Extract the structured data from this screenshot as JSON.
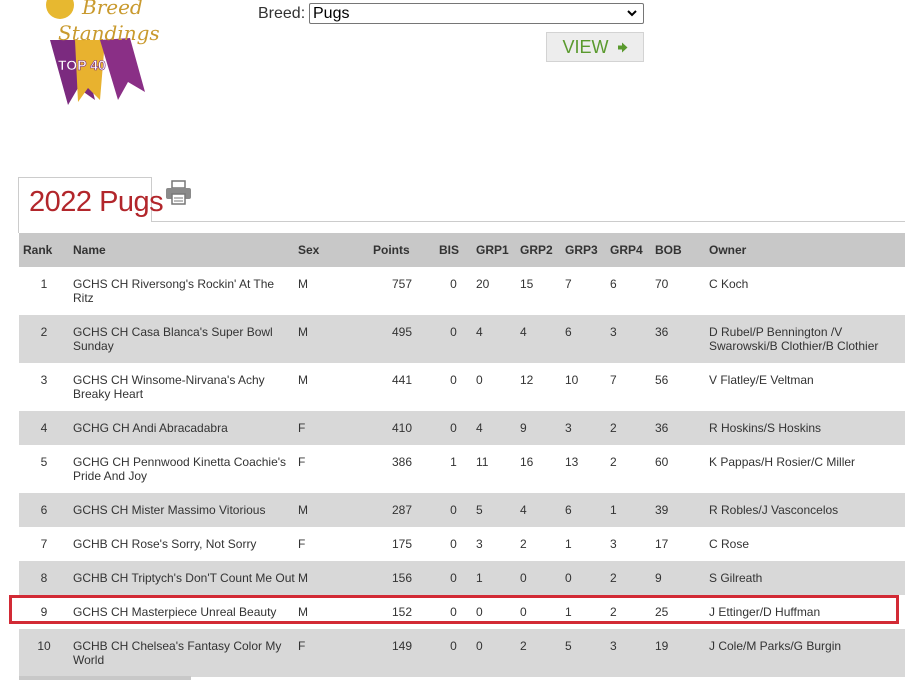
{
  "logo": {
    "text_script": "Breed Standings",
    "text_badge": "TOP 40"
  },
  "breed_selector": {
    "label": "Breed:",
    "selected": "Pugs"
  },
  "view_button": {
    "label": "VIEW"
  },
  "tab": {
    "title": "2022 Pugs"
  },
  "colors": {
    "accent_red": "#b2262b",
    "view_green": "#5a9a2e",
    "highlight": "#d22a35"
  },
  "table": {
    "headers": [
      "Rank",
      "Name",
      "Sex",
      "Points",
      "BIS",
      "GRP1",
      "GRP2",
      "GRP3",
      "GRP4",
      "BOB",
      "Owner"
    ],
    "rows": [
      {
        "rank": "1",
        "name": "GCHS CH Riversong's Rockin' At The Ritz",
        "sex": "M",
        "points": "757",
        "bis": "0",
        "grp1": "20",
        "grp2": "15",
        "grp3": "7",
        "grp4": "6",
        "bob": "70",
        "owner": "C Koch"
      },
      {
        "rank": "2",
        "name": "GCHS CH Casa Blanca's Super Bowl Sunday",
        "sex": "M",
        "points": "495",
        "bis": "0",
        "grp1": "4",
        "grp2": "4",
        "grp3": "6",
        "grp4": "3",
        "bob": "36",
        "owner": "D Rubel/P Bennington /V Swarowski/B Clothier/B Clothier"
      },
      {
        "rank": "3",
        "name": "GCHS CH Winsome-Nirvana's Achy Breaky Heart",
        "sex": "M",
        "points": "441",
        "bis": "0",
        "grp1": "0",
        "grp2": "12",
        "grp3": "10",
        "grp4": "7",
        "bob": "56",
        "owner": "V Flatley/E Veltman"
      },
      {
        "rank": "4",
        "name": "GCHG CH Andi Abracadabra",
        "sex": "F",
        "points": "410",
        "bis": "0",
        "grp1": "4",
        "grp2": "9",
        "grp3": "3",
        "grp4": "2",
        "bob": "36",
        "owner": "R Hoskins/S Hoskins"
      },
      {
        "rank": "5",
        "name": "GCHG CH Pennwood Kinetta Coachie's Pride And Joy",
        "sex": "F",
        "points": "386",
        "bis": "1",
        "grp1": "11",
        "grp2": "16",
        "grp3": "13",
        "grp4": "2",
        "bob": "60",
        "owner": "K Pappas/H Rosier/C Miller"
      },
      {
        "rank": "6",
        "name": "GCHS CH Mister Massimo Vitorious",
        "sex": "M",
        "points": "287",
        "bis": "0",
        "grp1": "5",
        "grp2": "4",
        "grp3": "6",
        "grp4": "1",
        "bob": "39",
        "owner": "R Robles/J Vasconcelos"
      },
      {
        "rank": "7",
        "name": "GCHB CH Rose's Sorry, Not Sorry",
        "sex": "F",
        "points": "175",
        "bis": "0",
        "grp1": "3",
        "grp2": "2",
        "grp3": "1",
        "grp4": "3",
        "bob": "17",
        "owner": "C Rose"
      },
      {
        "rank": "8",
        "name": "GCHB CH Triptych's Don'T Count Me Out",
        "sex": "M",
        "points": "156",
        "bis": "0",
        "grp1": "1",
        "grp2": "0",
        "grp3": "0",
        "grp4": "2",
        "bob": "9",
        "owner": "S Gilreath"
      },
      {
        "rank": "9",
        "name": "GCHS CH Masterpiece Unreal Beauty",
        "sex": "M",
        "points": "152",
        "bis": "0",
        "grp1": "0",
        "grp2": "0",
        "grp3": "1",
        "grp4": "2",
        "bob": "25",
        "owner": "J Ettinger/D Huffman"
      },
      {
        "rank": "10",
        "name": "GCHB CH Chelsea's Fantasy Color My World",
        "sex": "F",
        "points": "149",
        "bis": "0",
        "grp1": "0",
        "grp2": "2",
        "grp3": "5",
        "grp4": "3",
        "bob": "19",
        "owner": "J Cole/M Parks/G Burgin"
      }
    ]
  }
}
